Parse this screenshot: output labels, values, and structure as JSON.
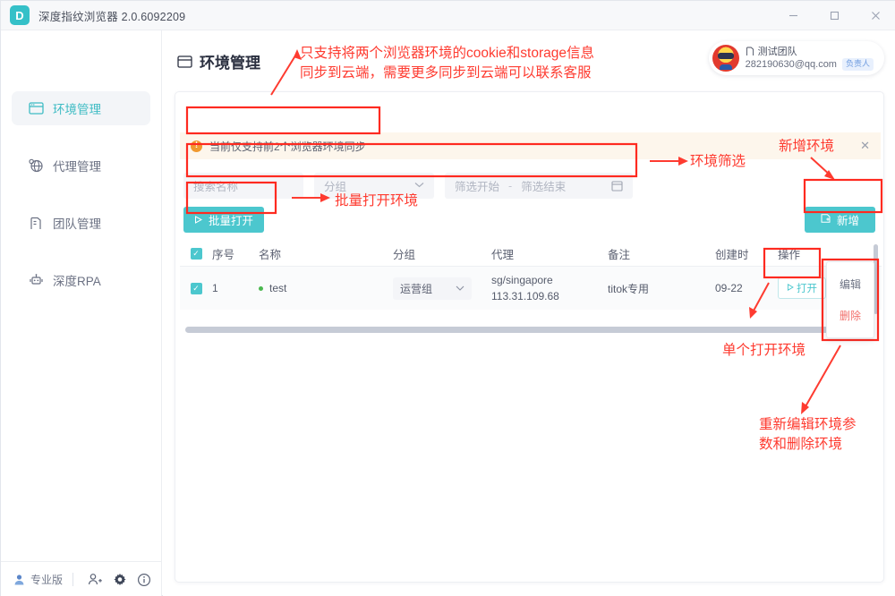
{
  "window": {
    "title": "深度指纹浏览器 2.0.6092209",
    "logo_letter": "D",
    "minimize": "—",
    "maximize": "□",
    "close": "✕"
  },
  "sidebar": {
    "items": [
      {
        "label": "环境管理",
        "icon": "window-icon",
        "active": true
      },
      {
        "label": "代理管理",
        "icon": "globe-icon",
        "active": false
      },
      {
        "label": "团队管理",
        "icon": "building-icon",
        "active": false
      },
      {
        "label": "深度RPA",
        "icon": "robot-icon",
        "active": false
      }
    ],
    "footer": {
      "pro_label": "专业版",
      "icons": [
        "add-user-icon",
        "gear-icon",
        "info-icon"
      ]
    }
  },
  "header": {
    "page_title": "环境管理",
    "user": {
      "team": "测试团队",
      "email": "282190630@qq.com",
      "badge": "负责人"
    }
  },
  "alert": {
    "text": "当前仅支持前2个浏览器环境同步",
    "close": "✕"
  },
  "filters": {
    "search_placeholder": "搜索名称",
    "group_placeholder": "分组",
    "date_start_placeholder": "筛选开始",
    "date_separator": "-",
    "date_end_placeholder": "筛选结束"
  },
  "toolbar": {
    "bulk_open_label": "批量打开",
    "add_label": "新增"
  },
  "table": {
    "headers": [
      "序号",
      "名称",
      "分组",
      "代理",
      "备注",
      "创建时",
      "操作"
    ],
    "header_checkbox_checked": true,
    "rows": [
      {
        "checked": true,
        "index": "1",
        "name": "test",
        "status": "online",
        "group": "运营组",
        "proxy_line1": "sg/singapore",
        "proxy_line2": "113.31.109.68",
        "note": "titok专用",
        "created": "09-22",
        "open_label": "打开",
        "more_label": "⋮"
      }
    ]
  },
  "context_menu": {
    "edit": "编辑",
    "delete": "删除"
  },
  "annotations": {
    "sync_note": "只支持将两个浏览器环境的cookie和storage信息\n同步到云端，需要更多同步到云端可以联系客服",
    "filter_note": "环境筛选",
    "add_note": "新增环境",
    "bulk_open_note": "批量打开环境",
    "single_open_note": "单个打开环境",
    "edit_delete_note": "重新编辑环境参\n数和删除环境"
  },
  "colors": {
    "accent_teal": "#4cc7ce",
    "annotation_red": "#fe3b30",
    "alert_bg": "#fdf6ec",
    "alert_icon": "#f0992f",
    "status_green": "#4ab84f",
    "badge_blue": "#6f9ce0",
    "danger": "#f2706c"
  }
}
